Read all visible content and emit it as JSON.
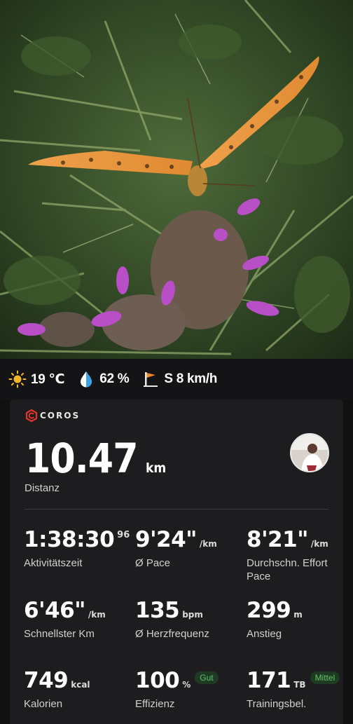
{
  "photo": {
    "description_icon": "butterfly-photo"
  },
  "weather": {
    "temperature": "19 ℃",
    "humidity": "62 %",
    "wind": "S 8 km/h",
    "icons": [
      "sun-icon",
      "water-drop-icon",
      "wind-flag-icon"
    ]
  },
  "card": {
    "brand": "COROS",
    "distance": {
      "value": "10.47",
      "unit": "km",
      "label": "Distanz"
    },
    "stats": [
      {
        "value": "1:38:30",
        "unit": "96",
        "label": "Aktivitätszeit"
      },
      {
        "value": "9'24\"",
        "unit": "/km",
        "label": "Ø Pace"
      },
      {
        "value": "8'21\"",
        "unit": "/km",
        "label": "Durchschn. Effort Pace"
      },
      {
        "value": "6'46\"",
        "unit": "/km",
        "label": "Schnellster Km"
      },
      {
        "value": "135",
        "unit": "bpm",
        "label": "Ø Herzfrequenz"
      },
      {
        "value": "299",
        "unit": "m",
        "label": "Anstieg"
      },
      {
        "value": "749",
        "unit": "kcal",
        "label": "Kalorien"
      },
      {
        "value": "100",
        "unit": "%",
        "badge": "Gut",
        "label": "Effizienz"
      },
      {
        "value": "171",
        "unit": "TB",
        "badge": "Mittel",
        "label": "Trainingsbel."
      }
    ]
  },
  "colors": {
    "accent_red": "#e0362c",
    "badge_green": "#63c26a",
    "card_bg": "#1d1d1f"
  }
}
